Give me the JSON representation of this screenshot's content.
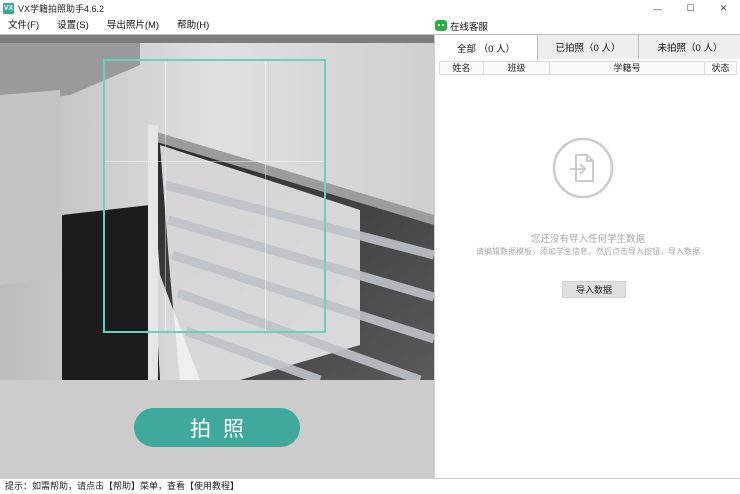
{
  "window": {
    "title": "VX学籍拍照助手4.6.2",
    "app_icon_label": "VX",
    "minimize_glyph": "—",
    "maximize_glyph": "☐",
    "close_glyph": "✕"
  },
  "menu": {
    "items": [
      "文件(F)",
      "设置(S)",
      "导出照片(M)",
      "帮助(H)"
    ],
    "service_label": "在线客服"
  },
  "camera": {
    "shoot_label": "拍照"
  },
  "tabs": [
    {
      "label": "全部 （0 人）",
      "active": true
    },
    {
      "label": "已拍照（0 人）",
      "active": false
    },
    {
      "label": "未拍照（0 人）",
      "active": false
    }
  ],
  "table": {
    "columns": [
      "姓名",
      "班级",
      "学籍号",
      "状态"
    ]
  },
  "empty_state": {
    "title": "您还没有导入任何学生数据",
    "hint": "请编辑数据模板，添加学生信息，然后点击导入按钮，导入数据",
    "import_label": "导入数据"
  },
  "status": {
    "text": "提示：如需帮助，请点击【帮助】菜单，查看【使用教程】"
  },
  "colors": {
    "accent": "#3fa99b",
    "frame": "#66d2bf",
    "wechat": "#2aae44"
  }
}
